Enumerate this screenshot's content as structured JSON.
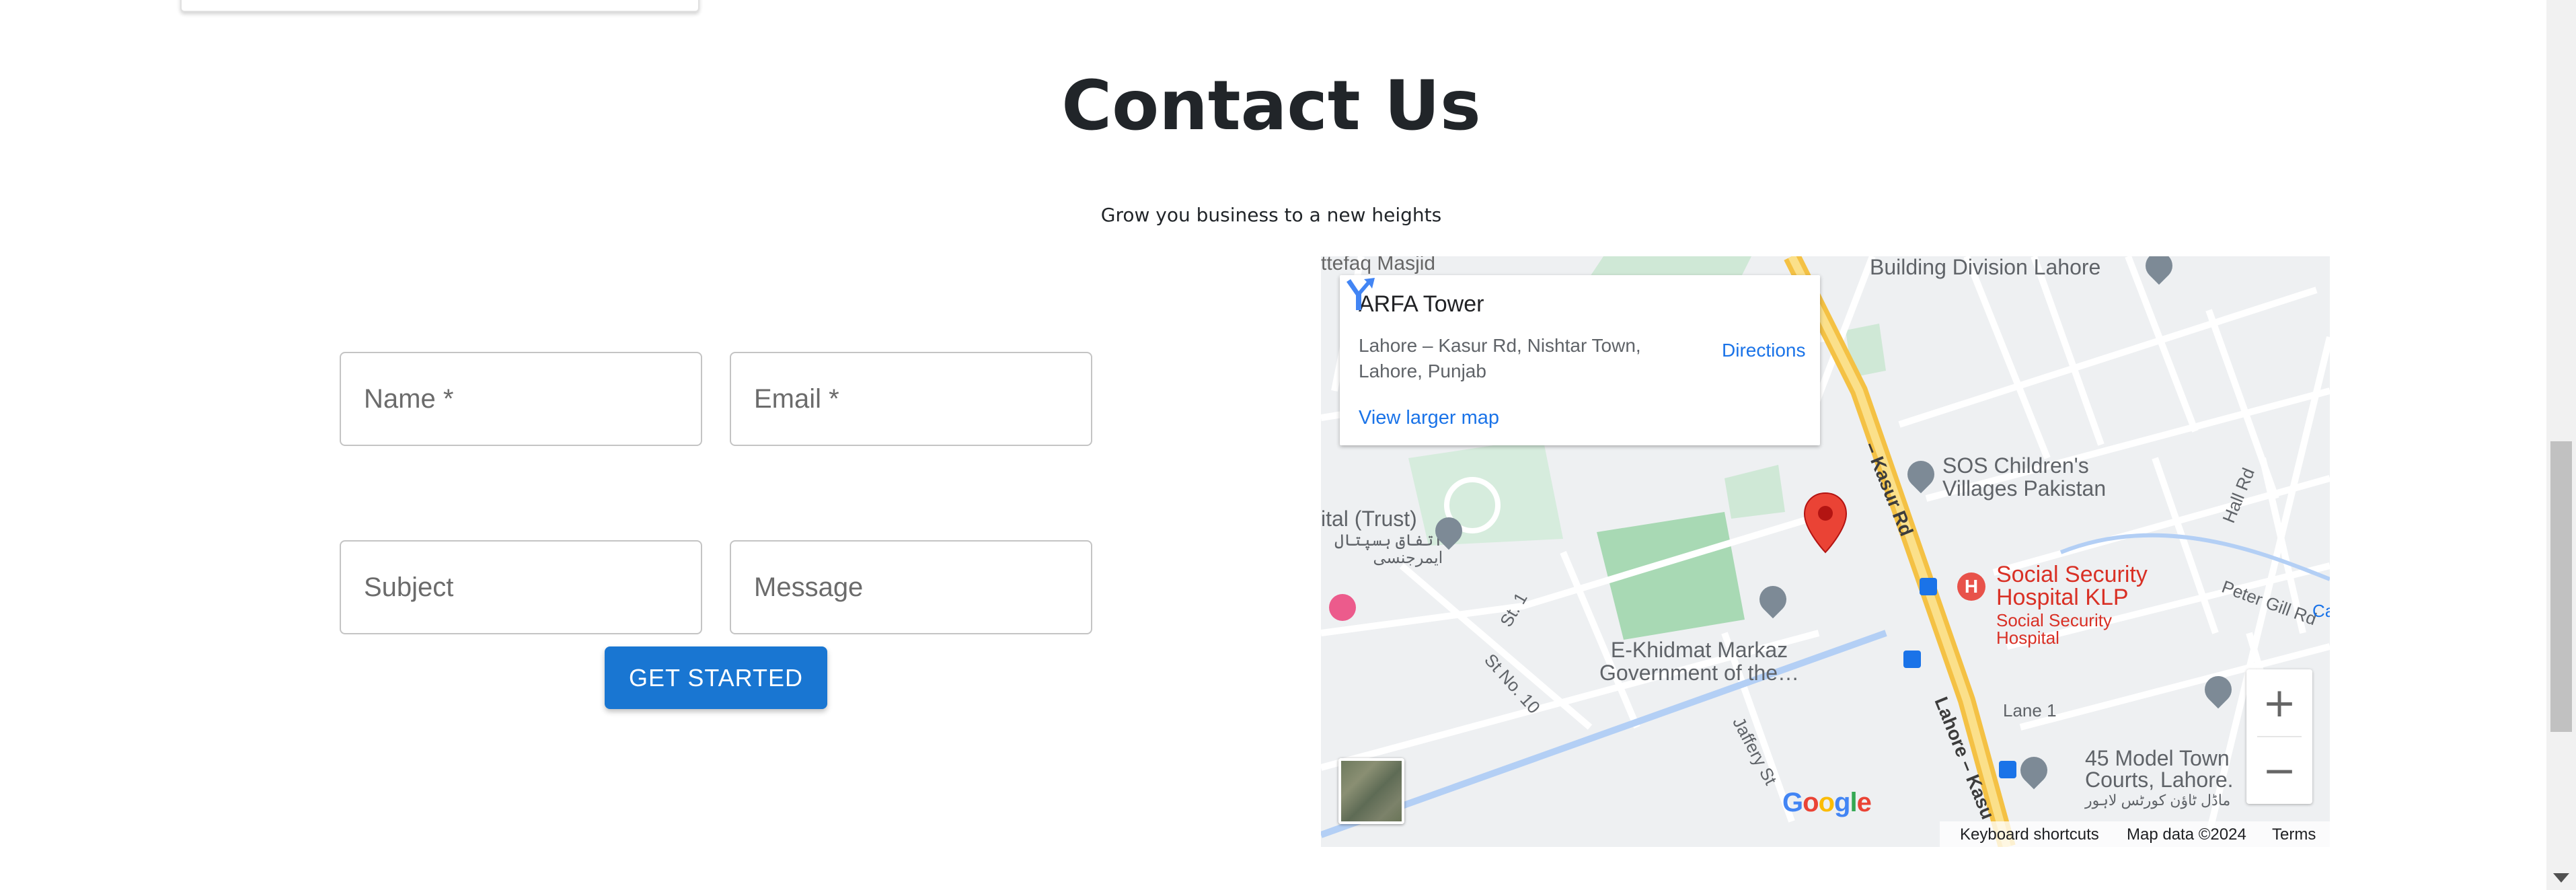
{
  "contact": {
    "title": "Contact Us",
    "subtitle": "Grow you business to a new heights"
  },
  "form": {
    "name_placeholder": "Name *",
    "email_placeholder": "Email *",
    "subject_placeholder": "Subject",
    "message_placeholder": "Message",
    "submit_label": "GET STARTED",
    "accent_color": "#1976d2"
  },
  "map": {
    "place_name": "ARFA Tower",
    "address": "Lahore – Kasur Rd, Nishtar Town, Lahore, Punjab",
    "view_larger_label": "View larger map",
    "directions_label": "Directions",
    "labels": {
      "masjid": "ttefaq Masjid",
      "building_division": "Building Division Lahore",
      "sos_line1": "SOS Children's",
      "sos_line2": "Villages Pakistan",
      "hall_rd": "Hall Rd",
      "peter_gill": "Peter Gill Rd",
      "social_security_line1": "Social Security",
      "social_security_line2": "Hospital KLP",
      "social_security_small1": "Social Security",
      "social_security_small2": "Hospital",
      "hospital_trust": "ital (Trust)",
      "urdu_1": "اتفاق ہسپتال",
      "urdu_2": "ایمرجنسی",
      "st1": "St. 1",
      "st10": "St No. 10",
      "ekhidmat_line1": "E-Khidmat Markaz",
      "ekhidmat_line2": "Government of the…",
      "jaffery": "Jaffery St",
      "kasur_rd": "– Kasur Rd",
      "lahore_kasu": "Lahore – Kasu",
      "lane1": "Lane 1",
      "model_town_line1": "45 Model Town",
      "model_town_line2": "Courts, Lahore.",
      "urdu_3": "ماڈل ٹاؤن کورٹس لاہور",
      "ca": "Ca"
    },
    "zoom_in": "+",
    "zoom_out": "−",
    "google": [
      "G",
      "o",
      "o",
      "g",
      "l",
      "e"
    ],
    "google_colors": [
      "#4285F4",
      "#EA4335",
      "#FBBC05",
      "#4285F4",
      "#34A853",
      "#EA4335"
    ],
    "footer": {
      "keyboard": "Keyboard shortcuts",
      "map_data": "Map data ©2024",
      "terms": "Terms"
    },
    "icons": {
      "directions": "directions-icon",
      "marker": "location-marker-icon",
      "satellite": "satellite-thumbnail"
    }
  }
}
